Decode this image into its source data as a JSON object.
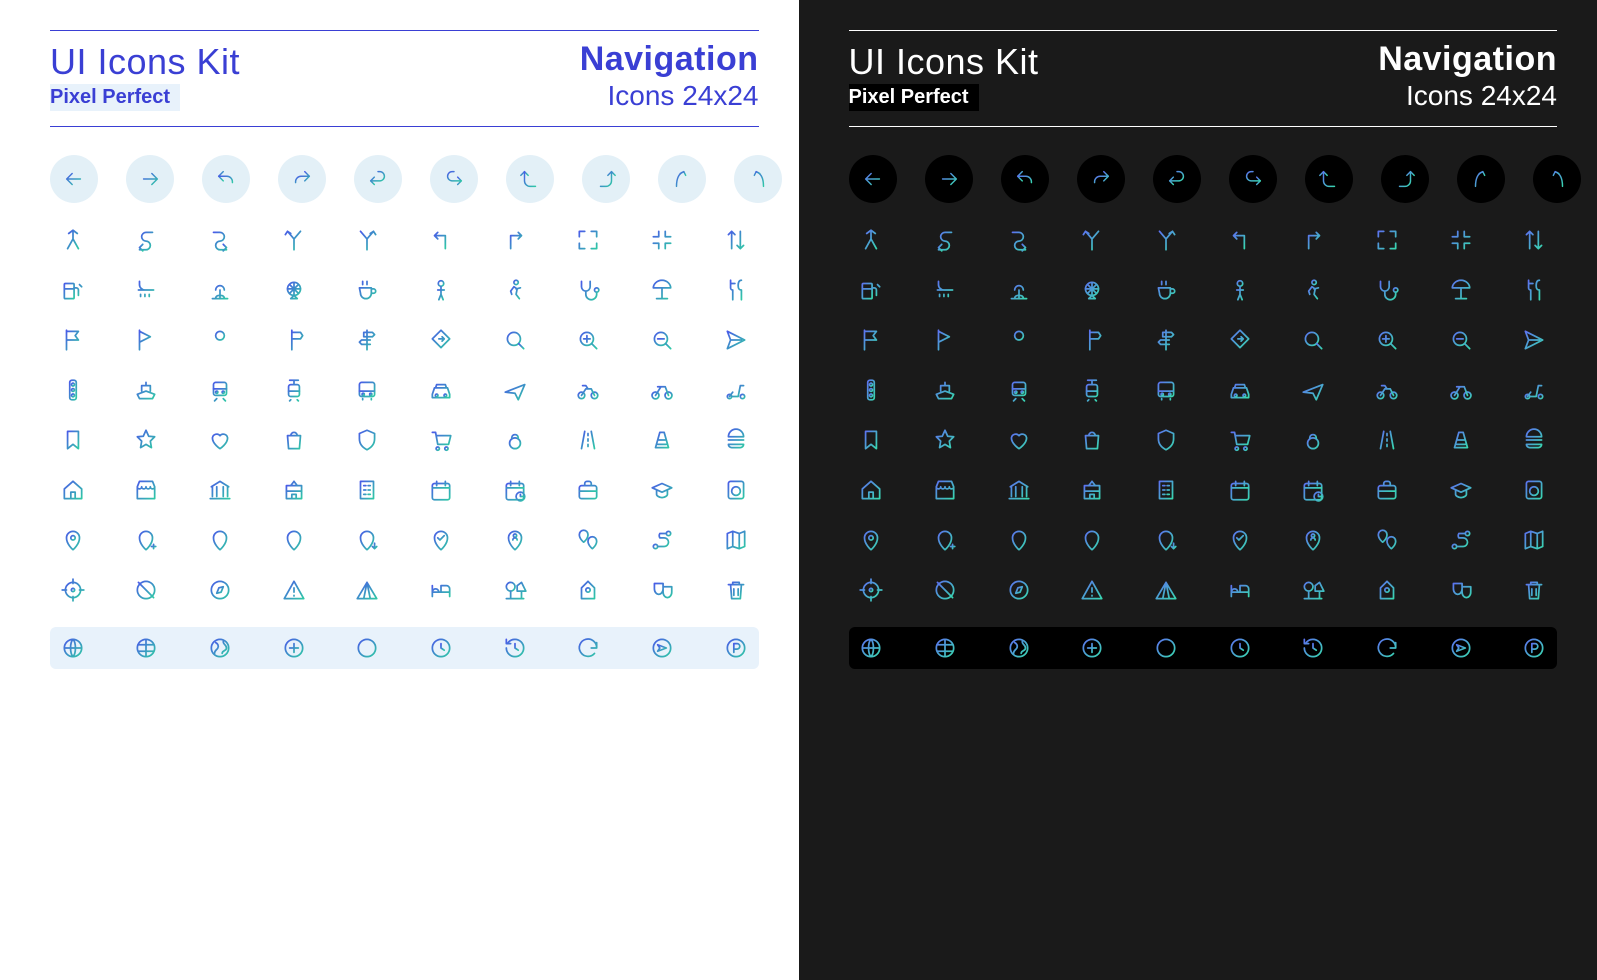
{
  "header": {
    "title": "UI Icons Kit",
    "subtitle": "Pixel Perfect",
    "category": "Navigation",
    "size_label": "Icons 24x24"
  },
  "colors": {
    "accent_light": "#3a3fd4",
    "panel_dark": "#1a1a1a",
    "chip_light": "#e8f2fb",
    "chip_dark": "#000000",
    "grad_start": "#4a5be8",
    "grad_end": "#2fc9a6"
  },
  "circle_row": [
    "arrow-left",
    "arrow-right",
    "undo",
    "redo",
    "turn-back-left",
    "turn-back-right",
    "turn-up-left",
    "turn-up-right",
    "curve-left",
    "curve-right"
  ],
  "rows": [
    [
      "merge",
      "s-curve-left",
      "s-curve-right",
      "fork-left",
      "fork-right",
      "turn-left-sharp",
      "turn-right-sharp",
      "expand",
      "contract",
      "swap-vertical"
    ],
    [
      "gas-station",
      "shower",
      "fountain",
      "ferris-wheel",
      "coffee",
      "person",
      "walking",
      "stethoscope",
      "beach-umbrella",
      "restaurant"
    ],
    [
      "flag-filled",
      "flag-outline",
      "pin-round",
      "signpost",
      "signposts",
      "direction-sign",
      "search",
      "zoom-in",
      "zoom-out",
      "send"
    ],
    [
      "traffic-light",
      "ship",
      "train",
      "tram",
      "bus",
      "car",
      "airplane",
      "motorcycle",
      "bicycle",
      "scooter"
    ],
    [
      "bookmark",
      "star",
      "heart",
      "shopping-bag",
      "shield",
      "shopping-cart",
      "kettlebell",
      "road",
      "traffic-cone",
      "burger"
    ],
    [
      "home",
      "storefront",
      "bank",
      "school",
      "office-building",
      "calendar",
      "calendar-clock",
      "briefcase",
      "graduation-cap",
      "washing-machine"
    ],
    [
      "map-pin",
      "map-pin-add",
      "map-pin-remove",
      "map-pin-alert",
      "map-pin-down",
      "map-pin-check",
      "map-pin-person",
      "pins-pair",
      "route",
      "map-fold"
    ],
    [
      "crosshair",
      "compass-off",
      "compass",
      "warning-triangle",
      "tent",
      "bed",
      "park-trees",
      "birdhouse",
      "theater-masks",
      "trash"
    ]
  ],
  "last_row": [
    "globe-grid",
    "globe-lines",
    "globe-shape",
    "circle-plus",
    "circle-minus",
    "clock",
    "history",
    "refresh",
    "send-circle",
    "parking"
  ]
}
